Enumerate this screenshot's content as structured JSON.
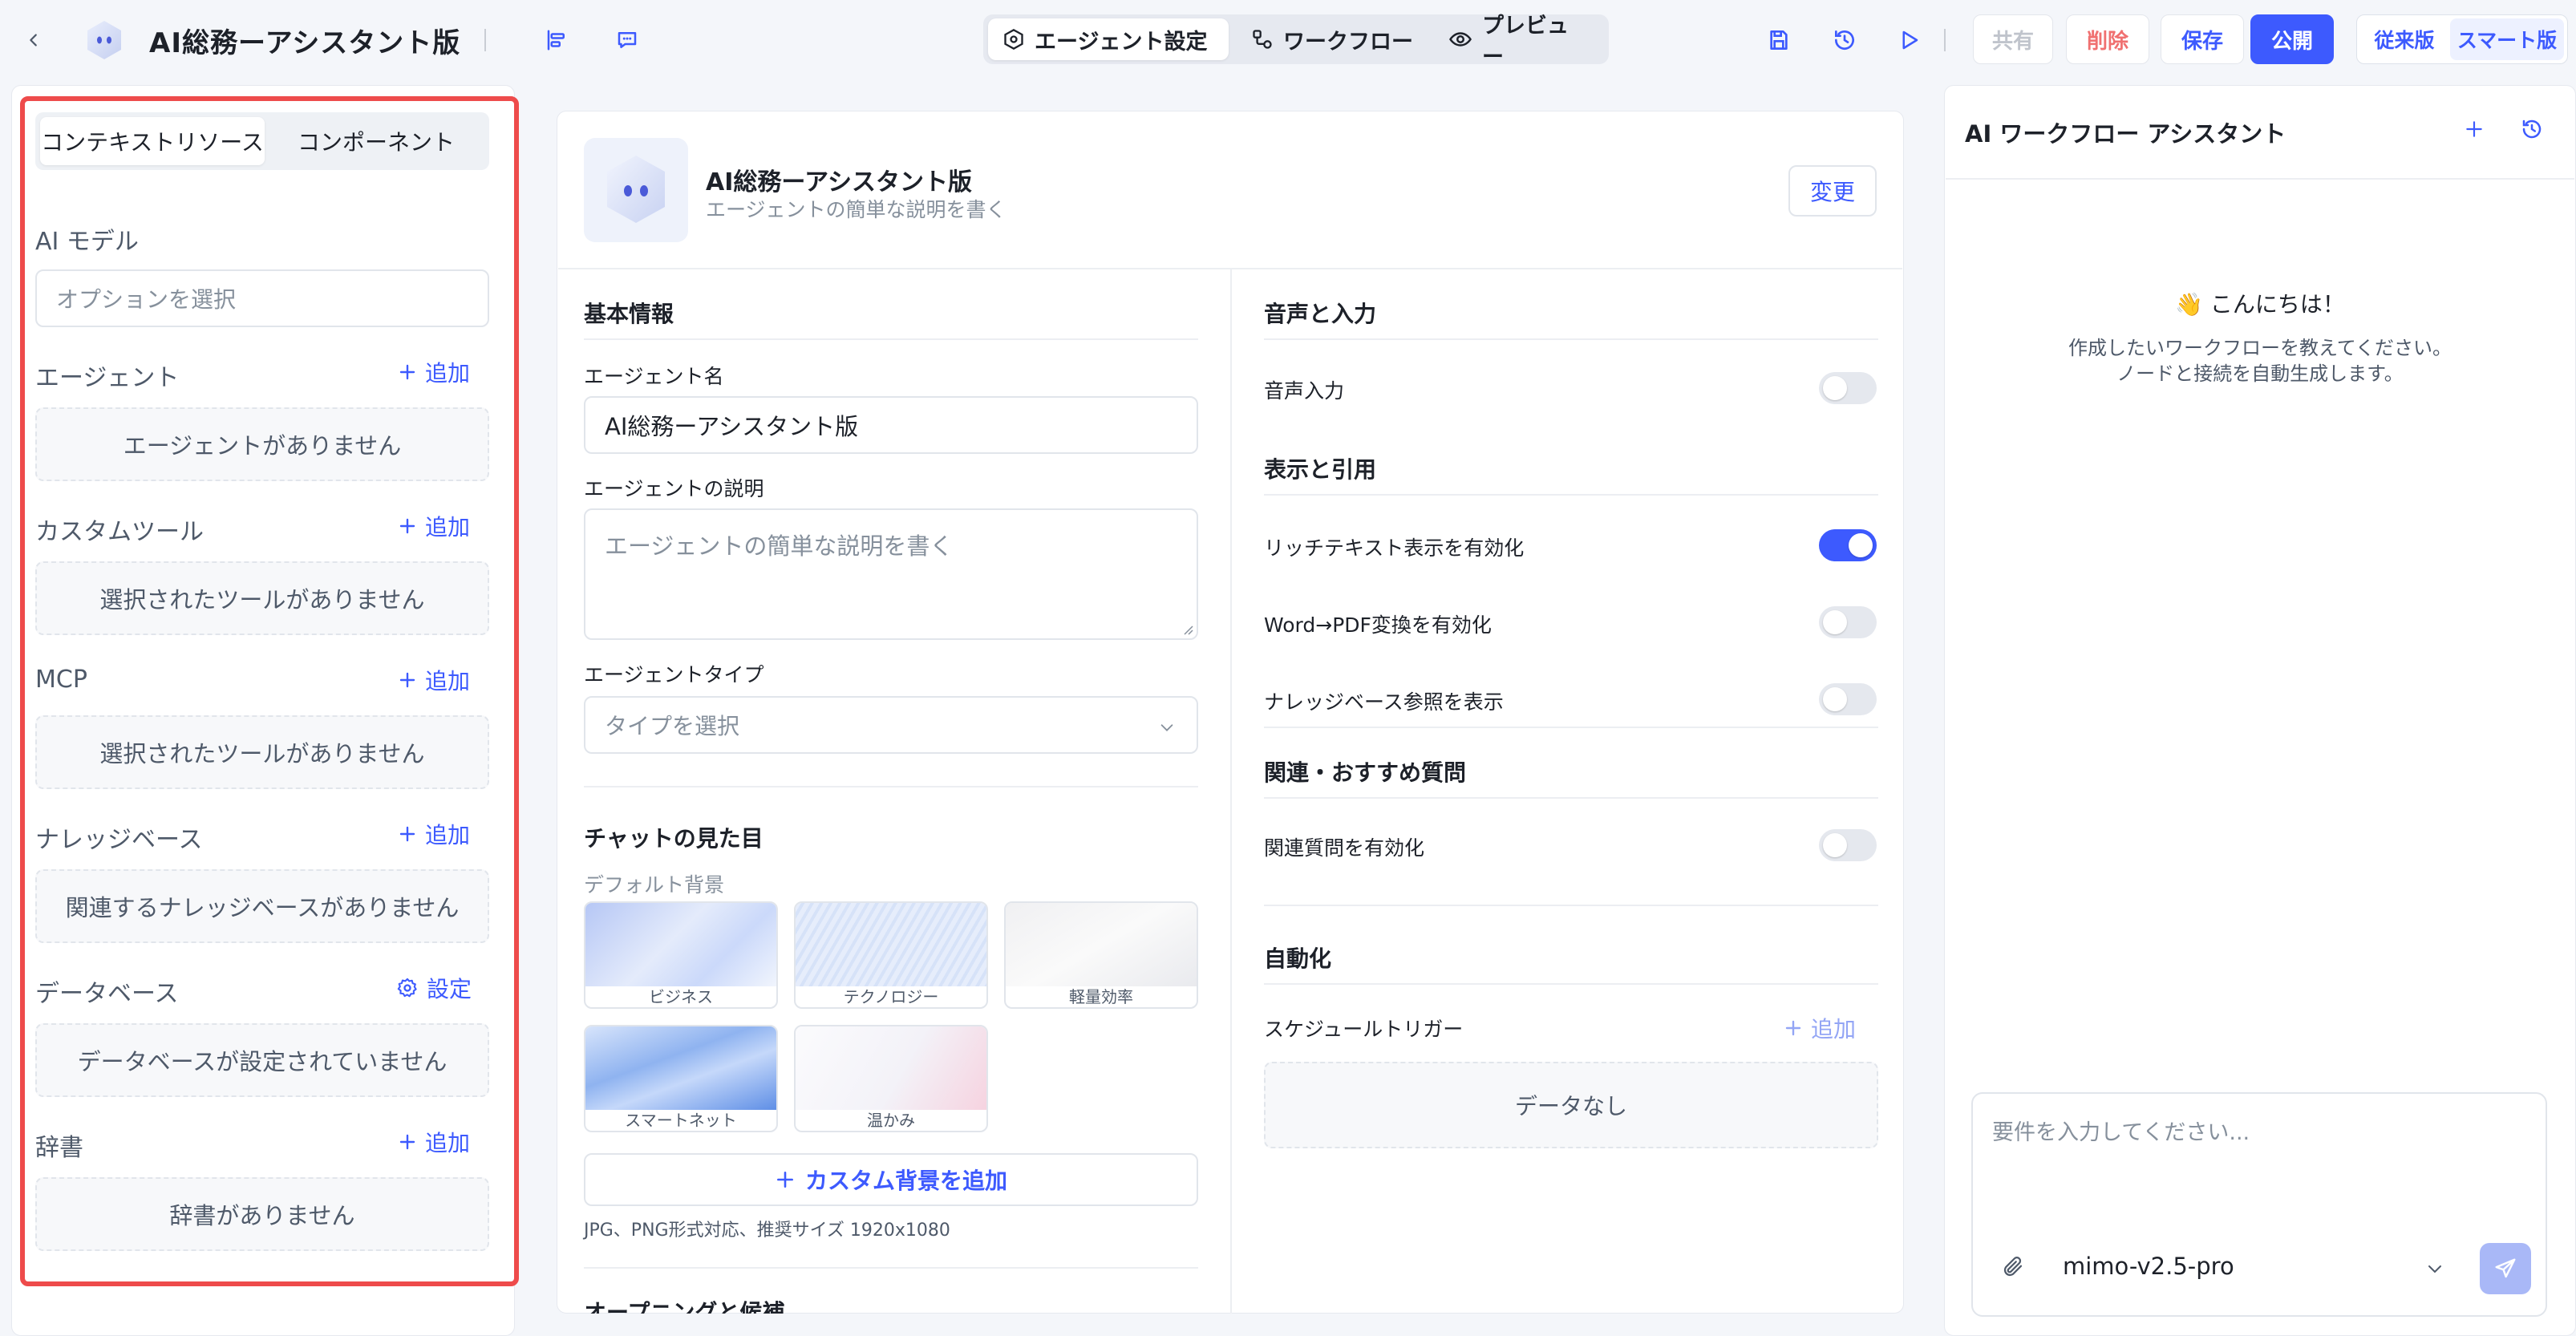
{
  "header": {
    "title": "AI総務ーアシスタント版",
    "tabs": [
      {
        "label": "エージェント設定",
        "icon": "settings-hex-icon",
        "active": true
      },
      {
        "label": "ワークフロー",
        "icon": "workflow-icon",
        "active": false
      },
      {
        "label": "プレビュー",
        "icon": "eye-icon",
        "active": false
      }
    ],
    "share_label": "共有",
    "delete_label": "削除",
    "save_label": "保存",
    "publish_label": "公開",
    "legacy_label": "従来版",
    "smart_label": "スマート版"
  },
  "left": {
    "tabs": [
      "コンテキストリソース",
      "コンポーネント"
    ],
    "ai_model": {
      "label": "AI モデル",
      "placeholder": "オプションを選択"
    },
    "sections": [
      {
        "label": "エージェント",
        "action": "追加",
        "empty": "エージェントがありません"
      },
      {
        "label": "カスタムツール",
        "action": "追加",
        "empty": "選択されたツールがありません"
      },
      {
        "label": "MCP",
        "action": "追加",
        "empty": "選択されたツールがありません"
      },
      {
        "label": "ナレッジベース",
        "action": "追加",
        "empty": "関連するナレッジベースがありません"
      },
      {
        "label": "データベース",
        "action": "設定",
        "empty": "データベースが設定されていません"
      },
      {
        "label": "辞書",
        "action": "追加",
        "empty": "辞書がありません"
      }
    ]
  },
  "agent_card": {
    "name": "AI総務ーアシスタント版",
    "description": "エージェントの簡単な説明を書く",
    "change_label": "変更"
  },
  "basic": {
    "title": "基本情報",
    "name_label": "エージェント名",
    "name_value": "AI総務ーアシスタント版",
    "desc_label": "エージェントの説明",
    "desc_placeholder": "エージェントの簡単な説明を書く",
    "type_label": "エージェントタイプ",
    "type_placeholder": "タイプを選択"
  },
  "appearance": {
    "title": "チャットの見た目",
    "default_bg_label": "デフォルト背景",
    "backgrounds": [
      "ビジネス",
      "テクノロジー",
      "軽量効率",
      "スマートネット",
      "温かみ"
    ],
    "add_custom_label": "カスタム背景を追加",
    "hint": "JPG、PNG形式対応、推奨サイズ 1920x1080",
    "next_section_partial": "オープニングと候補"
  },
  "settings": {
    "voice": {
      "title": "音声と入力",
      "items": [
        {
          "label": "音声入力",
          "on": false
        }
      ]
    },
    "display": {
      "title": "表示と引用",
      "items": [
        {
          "label": "リッチテキスト表示を有効化",
          "on": true
        },
        {
          "label": "Word→PDF変換を有効化",
          "on": false
        },
        {
          "label": "ナレッジベース参照を表示",
          "on": false
        }
      ]
    },
    "related": {
      "title": "関連・おすすめ質問",
      "items": [
        {
          "label": "関連質問を有効化",
          "on": false
        }
      ]
    },
    "automation": {
      "title": "自動化",
      "schedule_label": "スケジュールトリガー",
      "add_label": "追加",
      "empty": "データなし"
    }
  },
  "assistant": {
    "title": "AI ワークフロー アシスタント",
    "greeting": "👋 こんにちは！",
    "intro_line1": "作成したいワークフローを教えてください。",
    "intro_line2": "ノードと接続を自動生成します。",
    "input_placeholder": "要件を入力してください...",
    "model": "mimo-v2.5-pro"
  },
  "colors": {
    "accent": "#3d5afe",
    "danger": "#f07070",
    "highlight_frame": "#ee4b4b"
  }
}
